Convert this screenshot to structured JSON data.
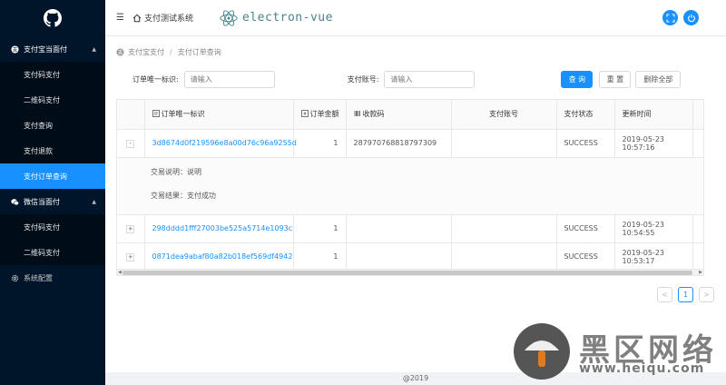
{
  "sidebar": {
    "groups": [
      {
        "label": "支付宝当面付",
        "items": [
          "支付码支付",
          "二维码支付",
          "支付查询",
          "支付退款",
          "支付订单查询"
        ]
      },
      {
        "label": "微信当面付",
        "items": [
          "支付码支付",
          "二维码支付"
        ]
      }
    ],
    "config_label": "系统配置",
    "active_item": "支付订单查询"
  },
  "header": {
    "home_label": "支付测试系统",
    "brand": "electron-vue"
  },
  "breadcrumb": [
    "支付宝支付",
    "支付订单查询"
  ],
  "search": {
    "order_id_label": "订单唯一标识:",
    "order_id_placeholder": "请输入",
    "account_label": "支付账号:",
    "account_placeholder": "请输入",
    "query_label": "查 询",
    "reset_label": "重 置",
    "delete_all_label": "删除全部"
  },
  "table": {
    "columns": [
      "订单唯一标识",
      "订单金额",
      "收款码",
      "支付账号",
      "支付状态",
      "更新时间"
    ],
    "rows": [
      {
        "expander": "-",
        "order_id": "3d8674d0f219596e8a00d76c96a9255d",
        "amount": "1",
        "code": "287970768818797309",
        "account": "",
        "status": "SUCCESS",
        "updated": "2019-05-23 10:57:16",
        "detail_desc": "交易说明：说明",
        "detail_result": "交易结果：支付成功"
      },
      {
        "expander": "+",
        "order_id": "298dddd1fff27003be525a5714e1093c",
        "amount": "1",
        "code": "",
        "account": "",
        "status": "SUCCESS",
        "updated": "2019-05-23 10:54:55"
      },
      {
        "expander": "+",
        "order_id": "0871dea9abaf80a82b018ef569df4942",
        "amount": "1",
        "code": "",
        "account": "",
        "status": "SUCCESS",
        "updated": "2019-05-23 10:53:17"
      }
    ]
  },
  "pagination": {
    "prev": "<",
    "current": "1",
    "next": ">"
  },
  "footer": "@2019",
  "watermark": {
    "text": "黑区网络",
    "url": "www.heiqu.com"
  },
  "colors": {
    "sidebar_bg": "#001529",
    "accent": "#1890ff",
    "link": "#1890ff"
  }
}
